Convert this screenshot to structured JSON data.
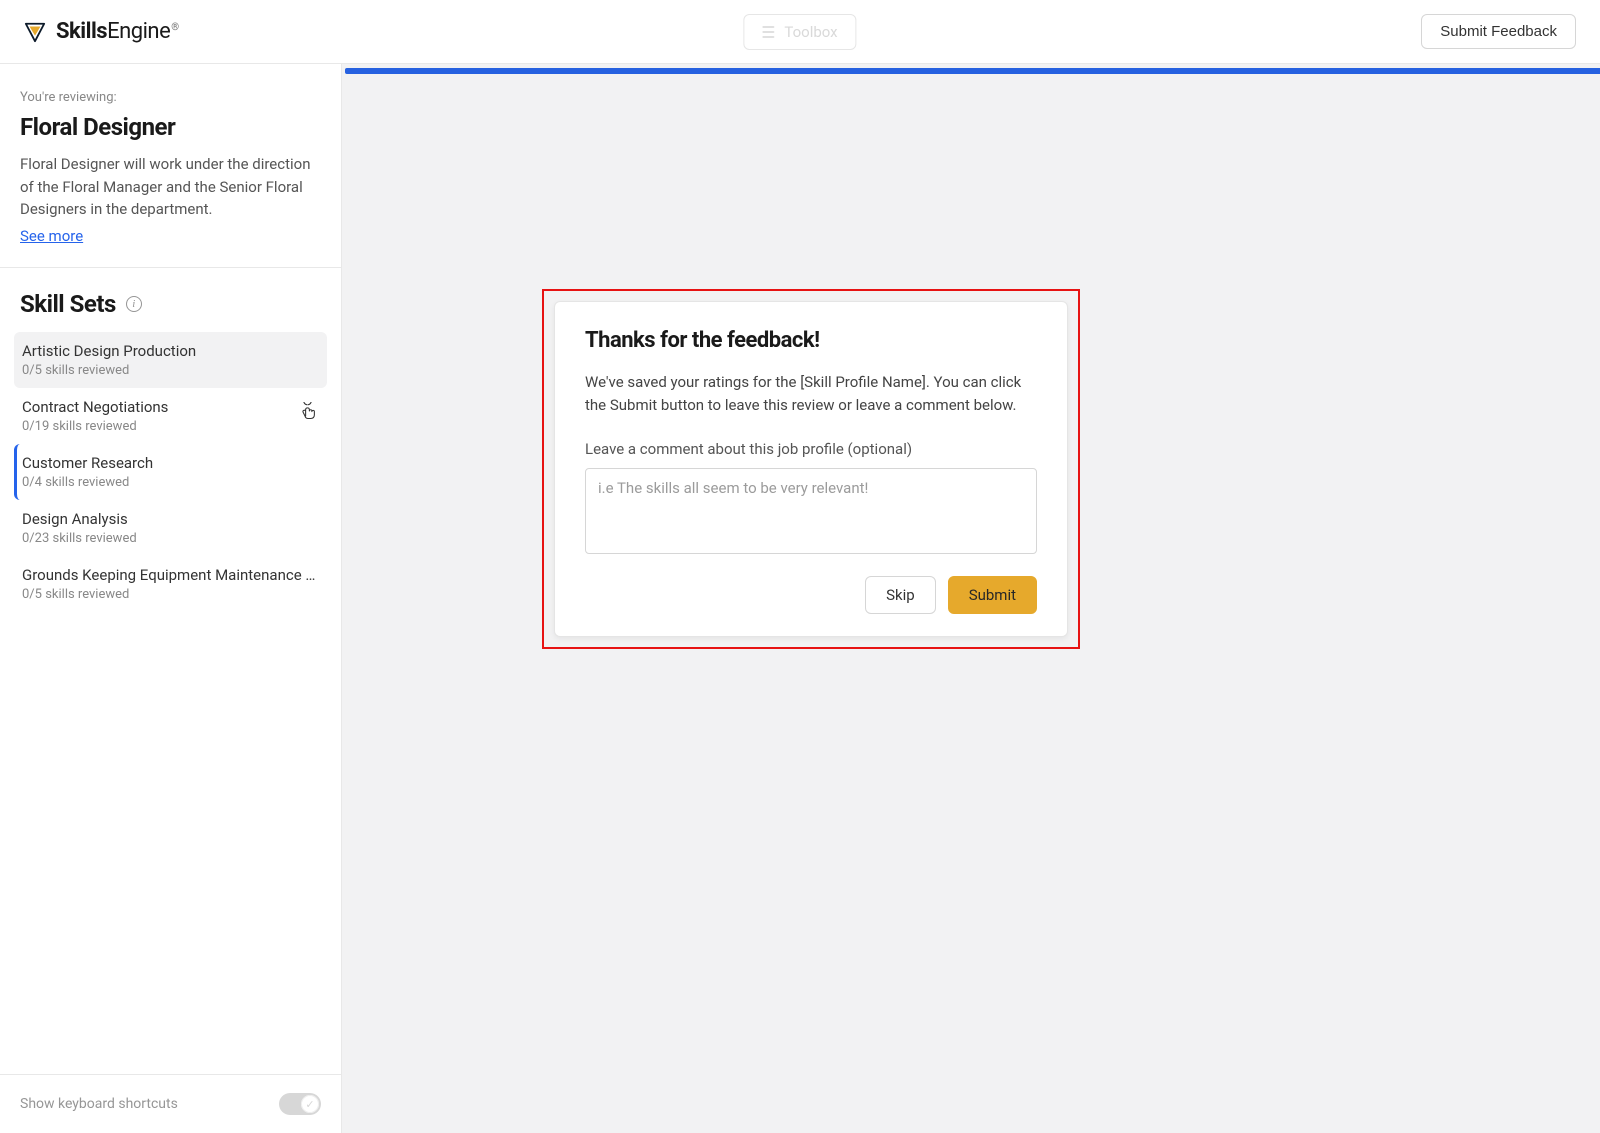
{
  "brand": {
    "name_bold": "Skills",
    "name_thin": "Engine"
  },
  "topbar": {
    "submit_feedback": "Submit Feedback",
    "ghost_label": "Toolbox"
  },
  "sidebar": {
    "intro_label": "You're reviewing:",
    "intro_title": "Floral Designer",
    "intro_desc": "Floral Designer will work under the direction of the Floral Manager and the Senior Floral Designers in the department.",
    "see_more": "See more",
    "skillsets_title": "Skill Sets",
    "items": [
      {
        "name": "Artistic Design Production",
        "sub": "0/5 skills reviewed",
        "hovered": true,
        "selected": false
      },
      {
        "name": "Contract Negotiations",
        "sub": "0/19 skills reviewed",
        "hovered": false,
        "selected": false
      },
      {
        "name": "Customer Research",
        "sub": "0/4 skills reviewed",
        "hovered": false,
        "selected": true
      },
      {
        "name": "Design Analysis",
        "sub": "0/23 skills reviewed",
        "hovered": false,
        "selected": false
      },
      {
        "name": "Grounds Keeping Equipment Maintenance and...",
        "sub": "0/5 skills reviewed",
        "hovered": false,
        "selected": false
      }
    ],
    "footer_label": "Show keyboard shortcuts"
  },
  "modal": {
    "title": "Thanks for the feedback!",
    "body": "We've saved your ratings for the [Skill Profile Name]. You can click the Submit button to leave this review or leave a comment below.",
    "comment_label": "Leave a comment about this job profile (optional)",
    "comment_placeholder": "i.e The skills all seem to be very relevant!",
    "skip": "Skip",
    "submit": "Submit"
  }
}
